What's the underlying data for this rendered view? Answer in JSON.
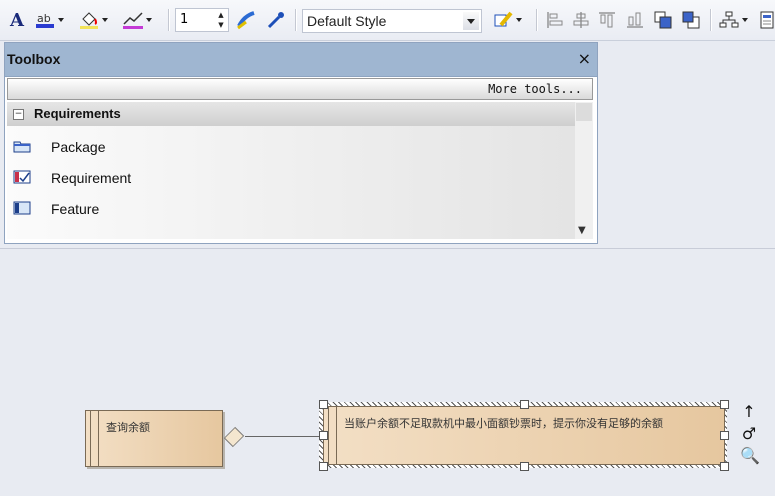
{
  "toolbar": {
    "line_width": "1",
    "style": "Default Style",
    "icons": [
      "font-icon",
      "font-color-icon",
      "fill-color-icon",
      "line-color-icon",
      "apply-appearance-icon",
      "eyedropper-icon",
      "apply-style-icon",
      "align-left-icon",
      "align-center-icon",
      "align-top-icon",
      "align-bottom-icon",
      "bring-to-front-icon",
      "send-to-back-icon",
      "layout-icon",
      "properties-icon"
    ]
  },
  "toolbox": {
    "title": "Toolbox",
    "close": "×",
    "more_tools": "More tools...",
    "section": {
      "label": "Requirements",
      "toggle": "−",
      "items": [
        {
          "label": "Package",
          "icon": "package-icon"
        },
        {
          "label": "Requirement",
          "icon": "requirement-icon"
        },
        {
          "label": "Feature",
          "icon": "feature-icon"
        }
      ]
    }
  },
  "diagram": {
    "element1": "查询余额",
    "element2": "当账户余额不足取款机中最小面额钞票时，提示你没有足够的余额",
    "side_tools": [
      "↑",
      "♂",
      "🔍"
    ]
  },
  "colors": {
    "toolbox_header": "#9fb6d1",
    "element_fill": "#ebd2b0",
    "canvas": "#e8ebf2"
  }
}
